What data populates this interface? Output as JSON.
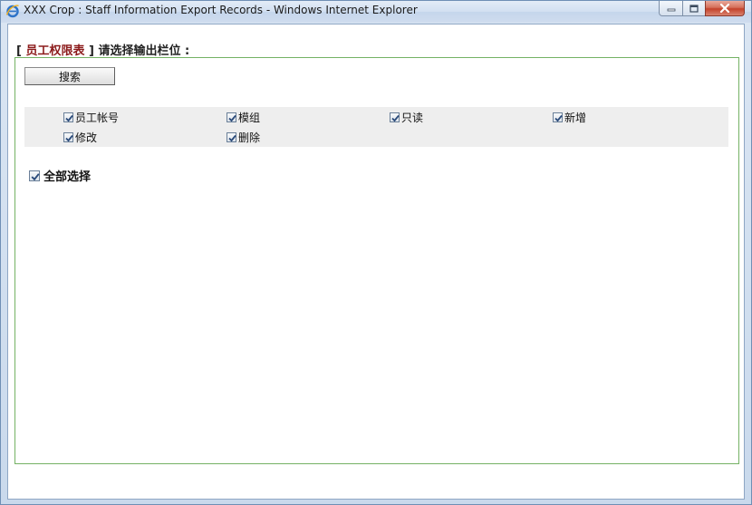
{
  "window": {
    "title": "XXX Crop : Staff Information Export Records - Windows Internet Explorer"
  },
  "header": {
    "open_bracket": "[",
    "table_name": "员工权限表",
    "prompt": "] 请选择输出栏位 :"
  },
  "search_button": {
    "label": "搜索"
  },
  "fields": [
    {
      "label": "员工帐号",
      "checked": true
    },
    {
      "label": "模组",
      "checked": true
    },
    {
      "label": "只读",
      "checked": true
    },
    {
      "label": "新增",
      "checked": true
    },
    {
      "label": "修改",
      "checked": true
    },
    {
      "label": "删除",
      "checked": true
    }
  ],
  "select_all": {
    "label": "全部选择",
    "checked": true
  },
  "colors": {
    "accent_red": "#8b1a1a",
    "panel_border": "#74b264",
    "field_background": "#eeeeee"
  },
  "icons": {
    "browser": "internet-explorer-icon",
    "minimize": "minimize-icon",
    "maximize": "maximize-icon",
    "close": "close-icon",
    "check": "checkmark-icon"
  }
}
